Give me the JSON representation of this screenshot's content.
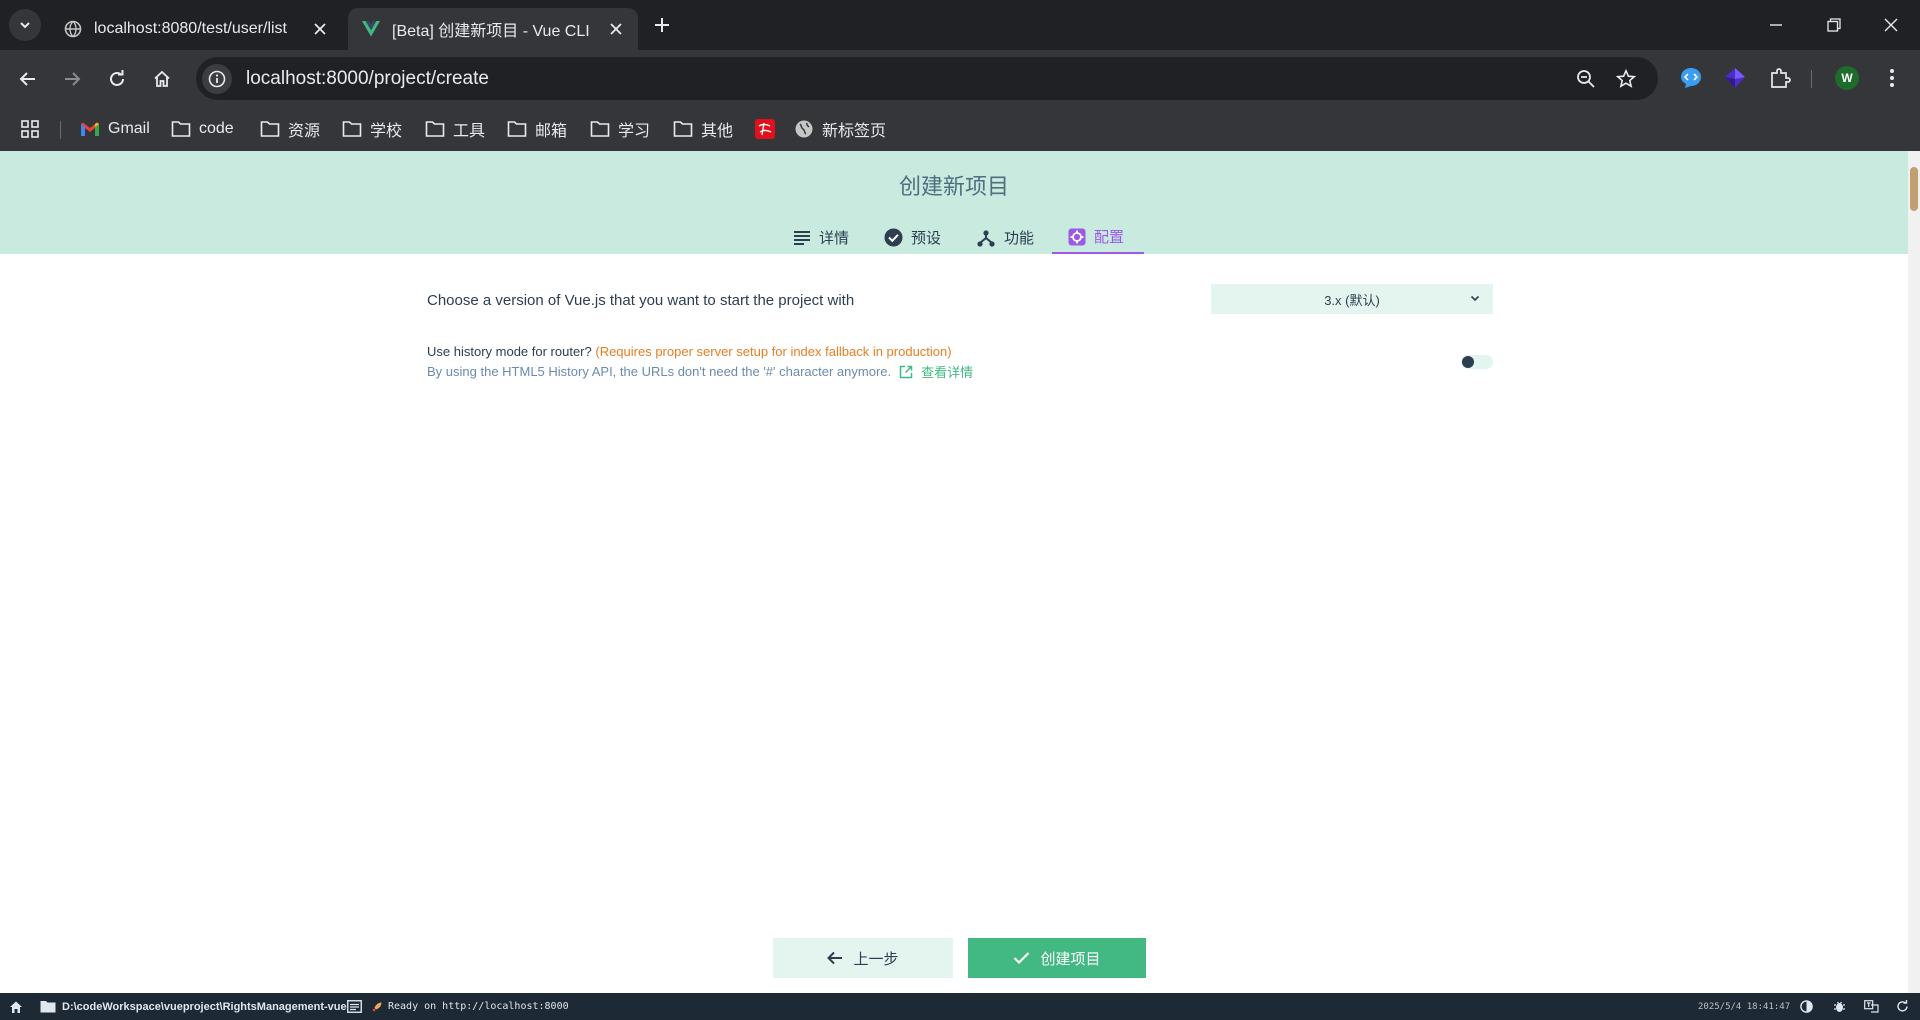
{
  "browser": {
    "tabs": [
      {
        "title": "localhost:8080/test/user/list",
        "active": false
      },
      {
        "title": "[Beta] 创建新项目 - Vue CLI",
        "active": true
      }
    ],
    "url": "localhost:8000/project/create",
    "profile_initial": "W",
    "bookmarks": [
      {
        "label": "Gmail",
        "icon": "gmail-icon"
      },
      {
        "label": "code",
        "icon": "folder-icon"
      },
      {
        "label": "资源",
        "icon": "folder-icon"
      },
      {
        "label": "学校",
        "icon": "folder-icon"
      },
      {
        "label": "工具",
        "icon": "folder-icon"
      },
      {
        "label": "邮箱",
        "icon": "folder-icon"
      },
      {
        "label": "学习",
        "icon": "folder-icon"
      },
      {
        "label": "其他",
        "icon": "folder-icon"
      },
      {
        "label": "",
        "icon": "red-badge-icon"
      },
      {
        "label": "新标签页",
        "icon": "globe-icon"
      }
    ]
  },
  "page": {
    "title": "创建新项目",
    "steps": [
      {
        "label": "详情",
        "icon": "list-icon"
      },
      {
        "label": "预设",
        "icon": "check-circle-icon"
      },
      {
        "label": "功能",
        "icon": "fork-icon"
      },
      {
        "label": "配置",
        "icon": "settings-icon",
        "active": true
      }
    ],
    "version_prompt": "Choose a version of Vue.js that you want to start the project with",
    "version_selected": "3.x (默认)",
    "history_prompt": "Use history mode for router?",
    "history_warning": "(Requires proper server setup for index fallback in production)",
    "history_desc": "By using the HTML5 History API, the URLs don't need the '#' character anymore.",
    "more_link": "查看详情",
    "history_enabled": false,
    "prev_button": "上一步",
    "create_button": "创建项目"
  },
  "statusbar": {
    "path": "D:\\codeWorkspace\\vueproject\\RightsManagement-vue",
    "log": "Ready on http://localhost:8000",
    "time": "2025/5/4 18:41:47"
  },
  "colors": {
    "accent_green": "#42b983",
    "header_bg": "#c9ebdf",
    "active_step": "#9b59e6",
    "warning": "#e67e22",
    "statusbar_bg": "#1d2935"
  }
}
